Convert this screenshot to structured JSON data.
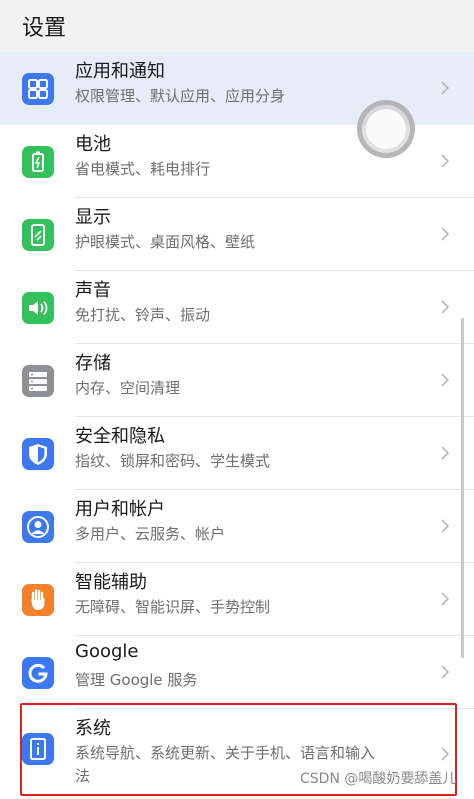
{
  "header": {
    "title": "设置"
  },
  "colors": {
    "highlight": "#e7ecf9",
    "blue": "#3d78ee",
    "green": "#34c05a",
    "gray": "#8d9094",
    "orange": "#f2812b",
    "red_outline": "#e02020"
  },
  "items": [
    {
      "name": "apps-notifications",
      "icon": "apps-grid-icon",
      "title": "应用和通知",
      "subtitle": "权限管理、默认应用、应用分身"
    },
    {
      "name": "battery",
      "icon": "battery-icon",
      "title": "电池",
      "subtitle": "省电模式、耗电排行"
    },
    {
      "name": "display",
      "icon": "display-icon",
      "title": "显示",
      "subtitle": "护眼模式、桌面风格、壁纸"
    },
    {
      "name": "sound",
      "icon": "speaker-icon",
      "title": "声音",
      "subtitle": "免打扰、铃声、振动"
    },
    {
      "name": "storage",
      "icon": "storage-icon",
      "title": "存储",
      "subtitle": "内存、空间清理"
    },
    {
      "name": "security-privacy",
      "icon": "shield-icon",
      "title": "安全和隐私",
      "subtitle": "指纹、锁屏和密码、学生模式"
    },
    {
      "name": "users-accounts",
      "icon": "user-icon",
      "title": "用户和帐户",
      "subtitle": "多用户、云服务、帐户"
    },
    {
      "name": "smart-assist",
      "icon": "hand-icon",
      "title": "智能辅助",
      "subtitle": "无障碍、智能识屏、手势控制"
    },
    {
      "name": "google",
      "icon": "google-icon",
      "title": "Google",
      "subtitle": "管理 Google 服务"
    },
    {
      "name": "system",
      "icon": "system-info-icon",
      "title": "系统",
      "subtitle": "系统导航、系统更新、关于手机、语言和输入",
      "subtitle_wrap": "法"
    }
  ],
  "watermark": "CSDN @喝酸奶要舔盖儿"
}
